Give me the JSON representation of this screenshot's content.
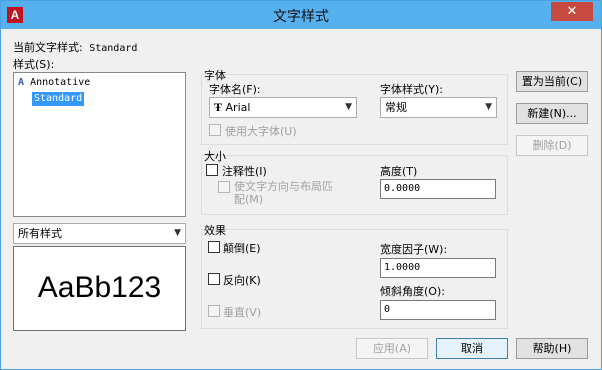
{
  "window": {
    "title": "文字样式",
    "app_icon_letter": "A"
  },
  "current_style": {
    "label": "当前文字样式:",
    "value": "Standard"
  },
  "styles": {
    "label": "样式(S):",
    "items": [
      "Annotative",
      "Standard"
    ],
    "selected": "Standard",
    "filter_value": "所有样式",
    "preview_text": "AaBb123"
  },
  "font": {
    "group_label": "字体",
    "name_label": "字体名(F):",
    "name_value": "Arial",
    "style_label": "字体样式(Y):",
    "style_value": "常规",
    "bigfont_label": "使用大字体(U)"
  },
  "size": {
    "group_label": "大小",
    "annotative_label": "注释性(I)",
    "match_orientation_label": "使文字方向与布局匹配(M)",
    "height_label": "高度(T)",
    "height_value": "0.0000"
  },
  "effects": {
    "group_label": "效果",
    "upside_down_label": "颠倒(E)",
    "backwards_label": "反向(K)",
    "vertical_label": "垂直(V)",
    "width_factor_label": "宽度因子(W):",
    "width_factor_value": "1.0000",
    "oblique_label": "倾斜角度(O):",
    "oblique_value": "0"
  },
  "buttons": {
    "set_current": "置为当前(C)",
    "new": "新建(N)...",
    "delete": "删除(D)",
    "apply": "应用(A)",
    "cancel": "取消",
    "help": "帮助(H)"
  }
}
